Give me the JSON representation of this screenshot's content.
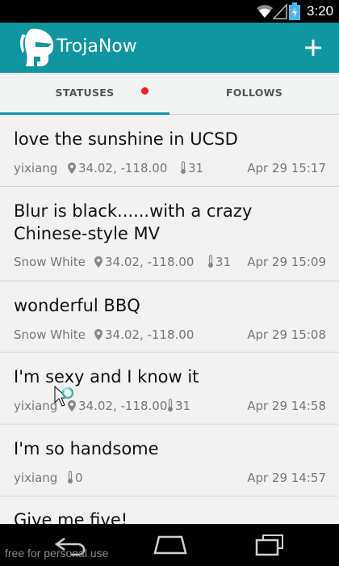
{
  "status_bar": {
    "time": "3:20"
  },
  "app": {
    "title": "TrojaNow",
    "add_icon": "plus-icon",
    "accent": "#1096a0"
  },
  "tabs": [
    {
      "label": "STATUSES",
      "selected": true,
      "has_notification": true
    },
    {
      "label": "FOLLOWS",
      "selected": false
    }
  ],
  "statuses": [
    {
      "text": "love the sunshine in UCSD",
      "author": "yixiang",
      "location": "34.02, -118.00",
      "temperature": "31",
      "time": "Apr 29 15:17"
    },
    {
      "text": "Blur is black......with a crazy Chinese-style MV",
      "author": "Snow White",
      "location": "34.02, -118.00",
      "temperature": "31",
      "time": "Apr 29 15:09"
    },
    {
      "text": "wonderful BBQ",
      "author": "Snow White",
      "location": "34.02, -118.00",
      "temperature": "",
      "time": "Apr 29 15:08"
    },
    {
      "text": "I'm sexy and I know it",
      "author": "yixiang",
      "location": "34.02, -118.00",
      "temperature": "31",
      "time": "Apr 29 14:58"
    },
    {
      "text": "I'm so handsome",
      "author": "yixiang",
      "location": "",
      "temperature": "0",
      "time": "Apr 29 14:57"
    },
    {
      "text": "Give me five!",
      "author": "",
      "location": "",
      "temperature": "",
      "time": ""
    }
  ],
  "watermark": "free for personal use"
}
